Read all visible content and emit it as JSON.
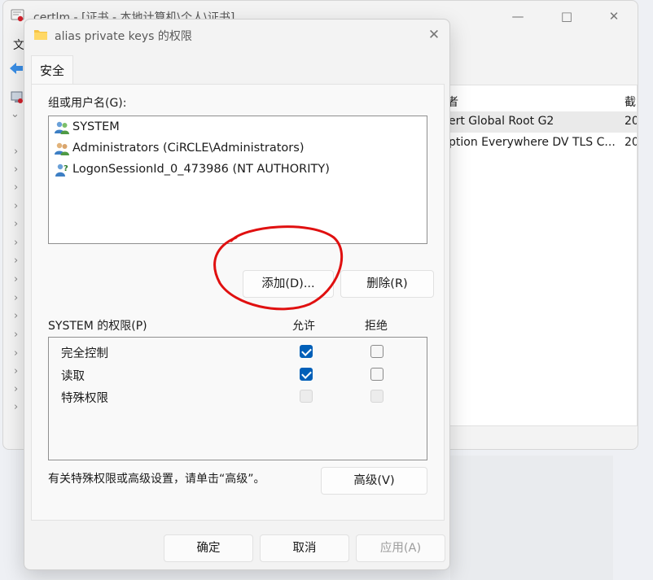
{
  "background_window": {
    "title": "certlm - [证书 - 本地计算机\\个人\\证书]",
    "menu_first": "文",
    "columns": [
      "者",
      "截"
    ],
    "rows": [
      {
        "name": "ert Global Root G2",
        "date": "20"
      },
      {
        "name": "ption Everywhere DV TLS C...",
        "date": "20"
      }
    ],
    "icons": {
      "app": "certificate-icon",
      "back": "back-arrow-icon",
      "tree": "computer-icon"
    }
  },
  "dialog": {
    "title": "alias private keys 的权限",
    "tab": "安全",
    "group_label": "组或用户名(G):",
    "users": [
      {
        "name": "SYSTEM",
        "icon": "users-icon"
      },
      {
        "name": "Administrators (CiRCLE\\Administrators)",
        "icon": "users-icon"
      },
      {
        "name": "LogonSessionId_0_473986 (NT AUTHORITY)",
        "icon": "unknown-user-icon"
      }
    ],
    "add_button": "添加(D)...",
    "remove_button": "删除(R)",
    "perm_label": "SYSTEM 的权限(P)",
    "allow_header": "允许",
    "deny_header": "拒绝",
    "permissions": [
      {
        "name": "完全控制",
        "allow": "checked",
        "deny": "unchecked"
      },
      {
        "name": "读取",
        "allow": "checked",
        "deny": "unchecked"
      },
      {
        "name": "特殊权限",
        "allow": "disabled",
        "deny": "disabled"
      }
    ],
    "advanced_hint": "有关特殊权限或高级设置，请单击“高级”。",
    "advanced_button": "高级(V)",
    "ok_button": "确定",
    "cancel_button": "取消",
    "apply_button": "应用(A)"
  },
  "colors": {
    "accent": "#005fb8",
    "annotation": "#e01010"
  }
}
